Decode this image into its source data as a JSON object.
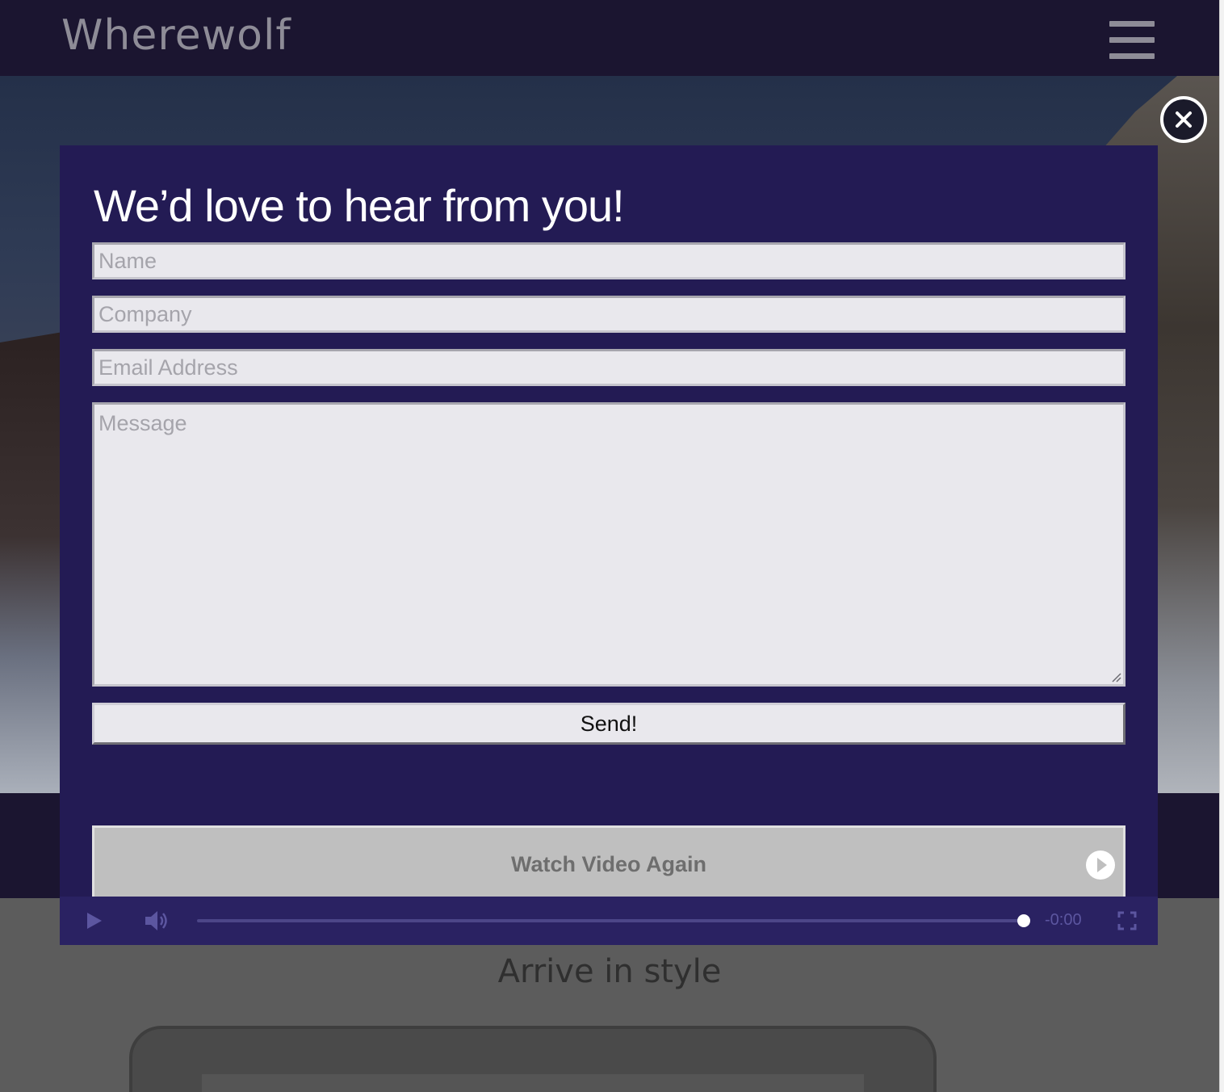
{
  "header": {
    "logo_text": "Wherewolf",
    "menu_icon": "hamburger-menu-icon"
  },
  "hero": {
    "image": "mountain-glacier-photo"
  },
  "modal": {
    "title": "We’d love to hear from you!",
    "close_icon": "close-icon",
    "fields": {
      "name_placeholder": "Name",
      "company_placeholder": "Company",
      "email_placeholder": "Email Address",
      "message_placeholder": "Message"
    },
    "send_label": "Send!",
    "watch_label": "Watch Video Again",
    "watch_icon": "play-circle-icon"
  },
  "player": {
    "time": "-0:00",
    "progress": 1.0,
    "icons": [
      "play-icon",
      "volume-icon",
      "fullscreen-icon"
    ]
  },
  "section": {
    "title": "Arrive in style"
  },
  "colors": {
    "navbar": "#1b1530",
    "modal_bg": "#231b54",
    "field_bg": "#e9e8ed",
    "watch_button_bg": "#bfbfbf",
    "player_bar": "#2a2262",
    "overlay_gray": "#5c5c5c"
  }
}
